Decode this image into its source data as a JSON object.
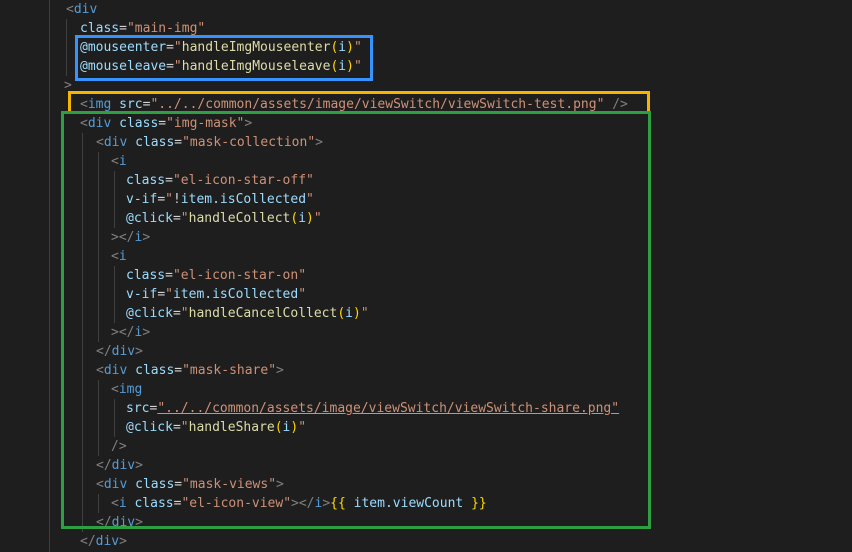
{
  "highlight_colors": {
    "event_handlers_box": "#3794ff",
    "img_line_box": "#f5b400",
    "img_mask_box": "#2ea043"
  },
  "lines": [
    {
      "tokens": [
        {
          "t": "<",
          "c": "punct"
        },
        {
          "t": "div",
          "c": "tag"
        }
      ]
    },
    {
      "tokens": [
        {
          "t": "class",
          "c": "attr"
        },
        {
          "t": "=",
          "c": "eq"
        },
        {
          "t": "\"main-img\"",
          "c": "str"
        }
      ]
    },
    {
      "tokens": [
        {
          "t": "@mouseenter",
          "c": "attr"
        },
        {
          "t": "=",
          "c": "eq"
        },
        {
          "t": "\"",
          "c": "str"
        },
        {
          "t": "handleImgMouseenter",
          "c": "strfn"
        },
        {
          "t": "(",
          "c": "paren"
        },
        {
          "t": "i",
          "c": "expr"
        },
        {
          "t": ")",
          "c": "paren"
        },
        {
          "t": "\"",
          "c": "str"
        }
      ]
    },
    {
      "tokens": [
        {
          "t": "@mouseleave",
          "c": "attr"
        },
        {
          "t": "=",
          "c": "eq"
        },
        {
          "t": "\"",
          "c": "str"
        },
        {
          "t": "handleImgMouseleave",
          "c": "strfn"
        },
        {
          "t": "(",
          "c": "paren"
        },
        {
          "t": "i",
          "c": "expr"
        },
        {
          "t": ")",
          "c": "paren"
        },
        {
          "t": "\"",
          "c": "str"
        }
      ]
    },
    {
      "tokens": [
        {
          "t": ">",
          "c": "punct"
        }
      ]
    },
    {
      "tokens": [
        {
          "t": "<",
          "c": "punct"
        },
        {
          "t": "img",
          "c": "tag"
        },
        {
          "t": " ",
          "c": "eq"
        },
        {
          "t": "src",
          "c": "attr"
        },
        {
          "t": "=",
          "c": "eq"
        },
        {
          "t": "\"../../common/assets/image/viewSwitch/viewSwitch-test.png\"",
          "c": "str"
        },
        {
          "t": " />",
          "c": "punct"
        }
      ]
    },
    {
      "tokens": [
        {
          "t": "<",
          "c": "punct"
        },
        {
          "t": "div",
          "c": "tag"
        },
        {
          "t": " ",
          "c": "eq"
        },
        {
          "t": "class",
          "c": "attr"
        },
        {
          "t": "=",
          "c": "eq"
        },
        {
          "t": "\"img-mask\"",
          "c": "str"
        },
        {
          "t": ">",
          "c": "punct"
        }
      ]
    },
    {
      "tokens": [
        {
          "t": "<",
          "c": "punct"
        },
        {
          "t": "div",
          "c": "tag"
        },
        {
          "t": " ",
          "c": "eq"
        },
        {
          "t": "class",
          "c": "attr"
        },
        {
          "t": "=",
          "c": "eq"
        },
        {
          "t": "\"mask-collection\"",
          "c": "str"
        },
        {
          "t": ">",
          "c": "punct"
        }
      ]
    },
    {
      "tokens": [
        {
          "t": "<",
          "c": "punct"
        },
        {
          "t": "i",
          "c": "tag"
        }
      ]
    },
    {
      "tokens": [
        {
          "t": "class",
          "c": "attr"
        },
        {
          "t": "=",
          "c": "eq"
        },
        {
          "t": "\"el-icon-star-off\"",
          "c": "str"
        }
      ]
    },
    {
      "tokens": [
        {
          "t": "v-if",
          "c": "attr"
        },
        {
          "t": "=",
          "c": "eq"
        },
        {
          "t": "\"",
          "c": "str"
        },
        {
          "t": "!",
          "c": "excl"
        },
        {
          "t": "item.isCollected",
          "c": "expr"
        },
        {
          "t": "\"",
          "c": "str"
        }
      ]
    },
    {
      "tokens": [
        {
          "t": "@click",
          "c": "attr"
        },
        {
          "t": "=",
          "c": "eq"
        },
        {
          "t": "\"",
          "c": "str"
        },
        {
          "t": "handleCollect",
          "c": "strfn"
        },
        {
          "t": "(",
          "c": "paren"
        },
        {
          "t": "i",
          "c": "expr"
        },
        {
          "t": ")",
          "c": "paren"
        },
        {
          "t": "\"",
          "c": "str"
        }
      ]
    },
    {
      "tokens": [
        {
          "t": "></",
          "c": "punct"
        },
        {
          "t": "i",
          "c": "tag"
        },
        {
          "t": ">",
          "c": "punct"
        }
      ]
    },
    {
      "tokens": [
        {
          "t": "<",
          "c": "punct"
        },
        {
          "t": "i",
          "c": "tag"
        }
      ]
    },
    {
      "tokens": [
        {
          "t": "class",
          "c": "attr"
        },
        {
          "t": "=",
          "c": "eq"
        },
        {
          "t": "\"el-icon-star-on\"",
          "c": "str"
        }
      ]
    },
    {
      "tokens": [
        {
          "t": "v-if",
          "c": "attr"
        },
        {
          "t": "=",
          "c": "eq"
        },
        {
          "t": "\"",
          "c": "str"
        },
        {
          "t": "item.isCollected",
          "c": "expr"
        },
        {
          "t": "\"",
          "c": "str"
        }
      ]
    },
    {
      "tokens": [
        {
          "t": "@click",
          "c": "attr"
        },
        {
          "t": "=",
          "c": "eq"
        },
        {
          "t": "\"",
          "c": "str"
        },
        {
          "t": "handleCancelCollect",
          "c": "strfn"
        },
        {
          "t": "(",
          "c": "paren"
        },
        {
          "t": "i",
          "c": "expr"
        },
        {
          "t": ")",
          "c": "paren"
        },
        {
          "t": "\"",
          "c": "str"
        }
      ]
    },
    {
      "tokens": [
        {
          "t": "></",
          "c": "punct"
        },
        {
          "t": "i",
          "c": "tag"
        },
        {
          "t": ">",
          "c": "punct"
        }
      ]
    },
    {
      "tokens": [
        {
          "t": "</",
          "c": "punct"
        },
        {
          "t": "div",
          "c": "tag"
        },
        {
          "t": ">",
          "c": "punct"
        }
      ]
    },
    {
      "tokens": [
        {
          "t": "<",
          "c": "punct"
        },
        {
          "t": "div",
          "c": "tag"
        },
        {
          "t": " ",
          "c": "eq"
        },
        {
          "t": "class",
          "c": "attr"
        },
        {
          "t": "=",
          "c": "eq"
        },
        {
          "t": "\"mask-share\"",
          "c": "str"
        },
        {
          "t": ">",
          "c": "punct"
        }
      ]
    },
    {
      "tokens": [
        {
          "t": "<",
          "c": "punct"
        },
        {
          "t": "img",
          "c": "tag"
        }
      ]
    },
    {
      "tokens": [
        {
          "t": "src",
          "c": "attr"
        },
        {
          "t": "=",
          "c": "eq"
        },
        {
          "t": "\"../../common/assets/image/viewSwitch/viewSwitch-share.png\"",
          "c": "str",
          "u": true
        }
      ]
    },
    {
      "tokens": [
        {
          "t": "@click",
          "c": "attr"
        },
        {
          "t": "=",
          "c": "eq"
        },
        {
          "t": "\"",
          "c": "str"
        },
        {
          "t": "handleShare",
          "c": "strfn"
        },
        {
          "t": "(",
          "c": "paren"
        },
        {
          "t": "i",
          "c": "expr"
        },
        {
          "t": ")",
          "c": "paren"
        },
        {
          "t": "\"",
          "c": "str"
        }
      ]
    },
    {
      "tokens": [
        {
          "t": "/>",
          "c": "punct"
        }
      ]
    },
    {
      "tokens": [
        {
          "t": "</",
          "c": "punct"
        },
        {
          "t": "div",
          "c": "tag"
        },
        {
          "t": ">",
          "c": "punct"
        }
      ]
    },
    {
      "tokens": [
        {
          "t": "<",
          "c": "punct"
        },
        {
          "t": "div",
          "c": "tag"
        },
        {
          "t": " ",
          "c": "eq"
        },
        {
          "t": "class",
          "c": "attr"
        },
        {
          "t": "=",
          "c": "eq"
        },
        {
          "t": "\"mask-views\"",
          "c": "str"
        },
        {
          "t": ">",
          "c": "punct"
        }
      ]
    },
    {
      "tokens": [
        {
          "t": "<",
          "c": "punct"
        },
        {
          "t": "i",
          "c": "tag"
        },
        {
          "t": " ",
          "c": "eq"
        },
        {
          "t": "class",
          "c": "attr"
        },
        {
          "t": "=",
          "c": "eq"
        },
        {
          "t": "\"el-icon-view\"",
          "c": "str"
        },
        {
          "t": "></",
          "c": "punct"
        },
        {
          "t": "i",
          "c": "tag"
        },
        {
          "t": ">",
          "c": "punct"
        },
        {
          "t": "{{",
          "c": "brace"
        },
        {
          "t": " ",
          "c": "eq"
        },
        {
          "t": "item.viewCount",
          "c": "expr"
        },
        {
          "t": " ",
          "c": "eq"
        },
        {
          "t": "}}",
          "c": "brace"
        }
      ]
    },
    {
      "tokens": [
        {
          "t": "</",
          "c": "punct"
        },
        {
          "t": "div",
          "c": "tag"
        },
        {
          "t": ">",
          "c": "punct"
        }
      ]
    },
    {
      "tokens": [
        {
          "t": "</",
          "c": "punct"
        },
        {
          "t": "div",
          "c": "tag"
        },
        {
          "t": ">",
          "c": "punct"
        }
      ]
    }
  ]
}
